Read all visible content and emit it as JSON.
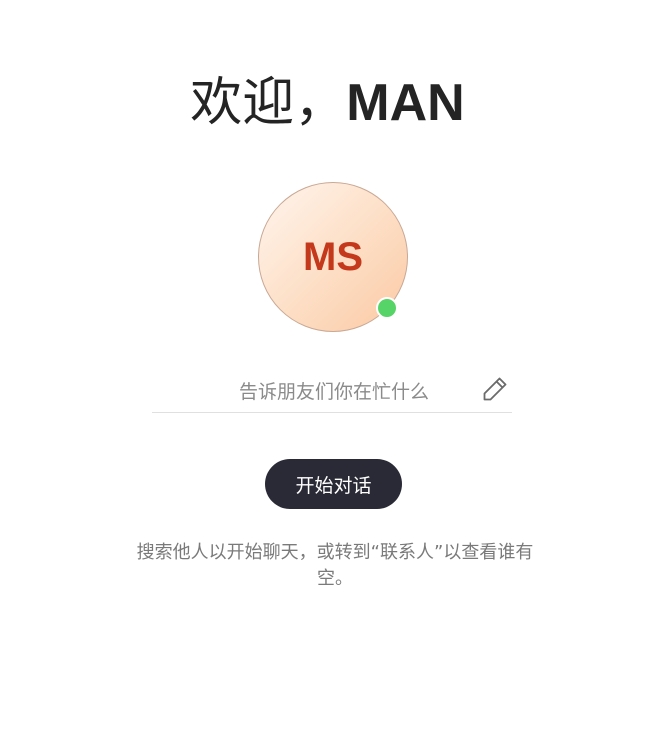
{
  "welcome": {
    "greeting": "欢迎，",
    "name": "MAN"
  },
  "avatar": {
    "initials": "MS",
    "presence": "online",
    "presence_color": "#57d467",
    "initials_color": "#c4391c"
  },
  "status": {
    "placeholder": "告诉朋友们你在忙什么",
    "value": "",
    "edit_icon": "pencil-icon"
  },
  "start_button": {
    "label": "开始对话",
    "color": "#292a35"
  },
  "hint": {
    "text": "搜索他人以开始聊天，或转到“联系人”以查看谁有空。"
  }
}
